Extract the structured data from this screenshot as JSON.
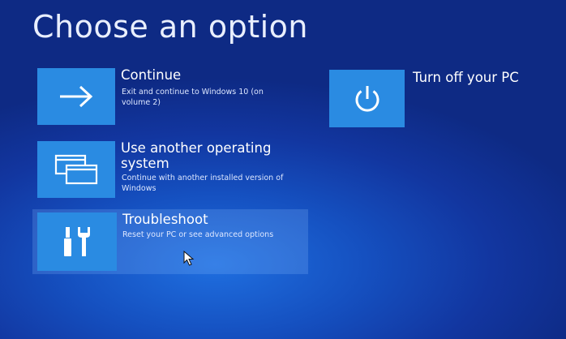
{
  "screen": {
    "title": "Choose an option"
  },
  "options": [
    {
      "title": "Continue",
      "description": "Exit and continue to Windows 10 (on volume 2)",
      "icon": "arrow-right-icon"
    },
    {
      "title": "Use another operating system",
      "description": "Continue with another installed version of Windows",
      "icon": "windows-stack-icon"
    },
    {
      "title": "Troubleshoot",
      "description": "Reset your PC or see advanced options",
      "icon": "tools-icon",
      "state": "hovered"
    },
    {
      "title": "Turn off your PC",
      "description": "",
      "icon": "power-icon"
    }
  ],
  "colors": {
    "background": "#1550c0",
    "tile": "#2a8be2",
    "hover_highlight": "#8cbeff"
  }
}
